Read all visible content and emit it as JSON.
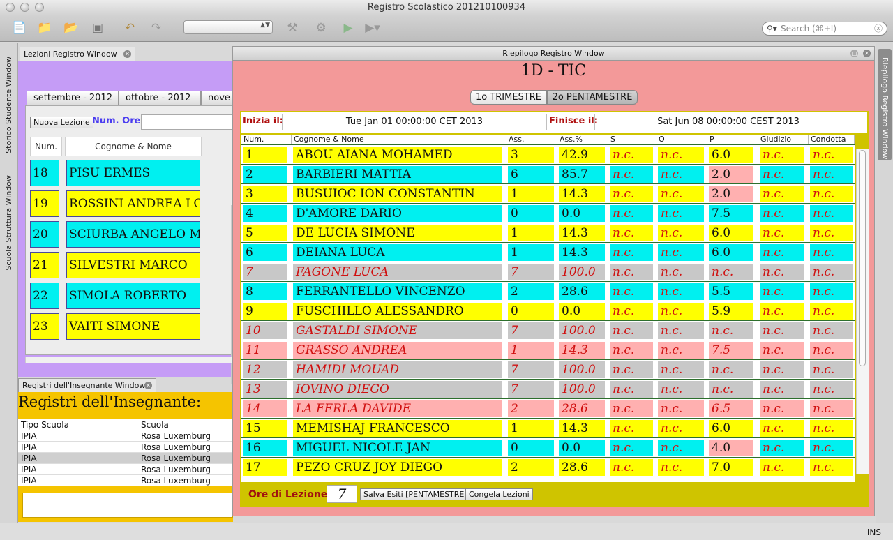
{
  "app": {
    "title": "Registro Scolastico 201210100934"
  },
  "search": {
    "placeholder": "Search (⌘+I)"
  },
  "side_tabs": {
    "left": [
      "Storico Studente Window",
      "Scuola Struttura Window"
    ],
    "right": "Riepilogo Registro Window"
  },
  "status": {
    "mode": "INS"
  },
  "lezioni": {
    "tab_title": "Lezioni Registro Window",
    "months": [
      "settembre - 2012",
      "ottobre - 2012",
      "nove"
    ],
    "new_button": "Nuova Lezione",
    "num_ore_label": "Num. Ore:",
    "headers": [
      "Num.",
      "Cognome & Nome"
    ],
    "rows": [
      {
        "num": "18",
        "name": "PISU ERMES",
        "color": "#00f0f0"
      },
      {
        "num": "19",
        "name": "ROSSINI ANDREA LO",
        "color": "#ffff00"
      },
      {
        "num": "20",
        "name": "SCIURBA ANGELO M.",
        "color": "#00f0f0"
      },
      {
        "num": "21",
        "name": "SILVESTRI MARCO",
        "color": "#ffff00"
      },
      {
        "num": "22",
        "name": "SIMOLA ROBERTO",
        "color": "#00f0f0"
      },
      {
        "num": "23",
        "name": "VAITI SIMONE",
        "color": "#ffff00"
      }
    ]
  },
  "registri": {
    "tab_title": "Registri dell'Insegnante Window",
    "title": "Registri dell'Insegnante:",
    "headers": [
      "Tipo Scuola",
      "Scuola"
    ],
    "rows": [
      {
        "tipo": "IPIA",
        "scuola": "Rosa Luxemburg"
      },
      {
        "tipo": "IPIA",
        "scuola": "Rosa Luxemburg"
      },
      {
        "tipo": "IPIA",
        "scuola": "Rosa Luxemburg"
      },
      {
        "tipo": "IPIA",
        "scuola": "Rosa Luxemburg"
      },
      {
        "tipo": "IPIA",
        "scuola": "Rosa Luxemburg"
      }
    ]
  },
  "riepilogo": {
    "window_title": "Riepilogo Registro Window",
    "class_title": "1D - TIC",
    "tabs": [
      "1o TRIMESTRE",
      "2o PENTAMESTRE"
    ],
    "active_tab": "2o PENTAMESTRE",
    "inizia_label": "Inizia il:",
    "inizia_value": "Tue Jan 01 00:00:00 CET 2013",
    "finisce_label": "Finisce il:",
    "finisce_value": "Sat Jun 08 00:00:00 CEST 2013",
    "columns": [
      "Num.",
      "Cognome & Nome",
      "Ass.",
      "Ass.%",
      "S",
      "O",
      "P",
      "Giudizio",
      "Condotta"
    ],
    "rows": [
      {
        "num": "1",
        "name": "ABOU AIANA MOHAMED",
        "ass": "3",
        "assp": "42.9",
        "s": "n.c.",
        "o": "n.c.",
        "p": "6.0",
        "giud": "n.c.",
        "cond": "n.c.",
        "color": "#ffff00",
        "italic": false,
        "p_color": "#ffff00"
      },
      {
        "num": "2",
        "name": "BARBIERI MATTIA",
        "ass": "6",
        "assp": "85.7",
        "s": "n.c.",
        "o": "n.c.",
        "p": "2.0",
        "giud": "n.c.",
        "cond": "n.c.",
        "color": "#00f0f0",
        "italic": false,
        "p_color": "#ffb0b0"
      },
      {
        "num": "3",
        "name": "BUSUIOC ION CONSTANTIN",
        "ass": "1",
        "assp": "14.3",
        "s": "n.c.",
        "o": "n.c.",
        "p": "2.0",
        "giud": "n.c.",
        "cond": "n.c.",
        "color": "#ffff00",
        "italic": false,
        "p_color": "#ffb0b0"
      },
      {
        "num": "4",
        "name": "D'AMORE DARIO",
        "ass": "0",
        "assp": "0.0",
        "s": "n.c.",
        "o": "n.c.",
        "p": "7.5",
        "giud": "n.c.",
        "cond": "n.c.",
        "color": "#00f0f0",
        "italic": false,
        "p_color": "#00f0f0"
      },
      {
        "num": "5",
        "name": "DE LUCIA SIMONE",
        "ass": "1",
        "assp": "14.3",
        "s": "n.c.",
        "o": "n.c.",
        "p": "6.0",
        "giud": "n.c.",
        "cond": "n.c.",
        "color": "#ffff00",
        "italic": false,
        "p_color": "#ffff00"
      },
      {
        "num": "6",
        "name": "DEIANA LUCA",
        "ass": "1",
        "assp": "14.3",
        "s": "n.c.",
        "o": "n.c.",
        "p": "6.0",
        "giud": "n.c.",
        "cond": "n.c.",
        "color": "#00f0f0",
        "italic": false,
        "p_color": "#00f0f0"
      },
      {
        "num": "7",
        "name": "FAGONE LUCA",
        "ass": "7",
        "assp": "100.0",
        "s": "n.c.",
        "o": "n.c.",
        "p": "n.c.",
        "giud": "n.c.",
        "cond": "n.c.",
        "color": "#c8c8c8",
        "italic": true,
        "p_color": "#c8c8c8"
      },
      {
        "num": "8",
        "name": "FERRANTELLO VINCENZO",
        "ass": "2",
        "assp": "28.6",
        "s": "n.c.",
        "o": "n.c.",
        "p": "5.5",
        "giud": "n.c.",
        "cond": "n.c.",
        "color": "#00f0f0",
        "italic": false,
        "p_color": "#00f0f0"
      },
      {
        "num": "9",
        "name": "FUSCHILLO ALESSANDRO",
        "ass": "0",
        "assp": "0.0",
        "s": "n.c.",
        "o": "n.c.",
        "p": "5.9",
        "giud": "n.c.",
        "cond": "n.c.",
        "color": "#ffff00",
        "italic": false,
        "p_color": "#ffff00"
      },
      {
        "num": "10",
        "name": "GASTALDI SIMONE",
        "ass": "7",
        "assp": "100.0",
        "s": "n.c.",
        "o": "n.c.",
        "p": "n.c.",
        "giud": "n.c.",
        "cond": "n.c.",
        "color": "#c8c8c8",
        "italic": true,
        "p_color": "#c8c8c8"
      },
      {
        "num": "11",
        "name": "GRASSO ANDREA",
        "ass": "1",
        "assp": "14.3",
        "s": "n.c.",
        "o": "n.c.",
        "p": "7.5",
        "giud": "n.c.",
        "cond": "n.c.",
        "color": "#ffb0b0",
        "italic": true,
        "p_color": "#ffb0b0"
      },
      {
        "num": "12",
        "name": "HAMIDI MOUAD",
        "ass": "7",
        "assp": "100.0",
        "s": "n.c.",
        "o": "n.c.",
        "p": "n.c.",
        "giud": "n.c.",
        "cond": "n.c.",
        "color": "#c8c8c8",
        "italic": true,
        "p_color": "#c8c8c8"
      },
      {
        "num": "13",
        "name": "IOVINO DIEGO",
        "ass": "7",
        "assp": "100.0",
        "s": "n.c.",
        "o": "n.c.",
        "p": "n.c.",
        "giud": "n.c.",
        "cond": "n.c.",
        "color": "#c8c8c8",
        "italic": true,
        "p_color": "#c8c8c8"
      },
      {
        "num": "14",
        "name": "LA FERLA DAVIDE",
        "ass": "2",
        "assp": "28.6",
        "s": "n.c.",
        "o": "n.c.",
        "p": "6.5",
        "giud": "n.c.",
        "cond": "n.c.",
        "color": "#ffb0b0",
        "italic": true,
        "p_color": "#ffb0b0"
      },
      {
        "num": "15",
        "name": "MEMISHAJ FRANCESCO",
        "ass": "1",
        "assp": "14.3",
        "s": "n.c.",
        "o": "n.c.",
        "p": "6.0",
        "giud": "n.c.",
        "cond": "n.c.",
        "color": "#ffff00",
        "italic": false,
        "p_color": "#ffff00"
      },
      {
        "num": "16",
        "name": "MIGUEL NICOLE JAN",
        "ass": "0",
        "assp": "0.0",
        "s": "n.c.",
        "o": "n.c.",
        "p": "4.0",
        "giud": "n.c.",
        "cond": "n.c.",
        "color": "#00f0f0",
        "italic": false,
        "p_color": "#ffb0b0"
      },
      {
        "num": "17",
        "name": "PEZO CRUZ JOY DIEGO",
        "ass": "2",
        "assp": "28.6",
        "s": "n.c.",
        "o": "n.c.",
        "p": "7.0",
        "giud": "n.c.",
        "cond": "n.c.",
        "color": "#ffff00",
        "italic": false,
        "p_color": "#ffff00"
      }
    ],
    "ore_label": "Ore di Lezione:",
    "ore_value": "7",
    "salva_button": "Salva Esiti [PENTAMESTRE]",
    "congela_button": "Congela Lezioni"
  },
  "colors": {
    "ok_cell_text": "#111111",
    "nc_cell_text": "#d01010",
    "lezioni_bg": "#c59cf6",
    "registri_bg": "#f5c400",
    "riepilogo_bg": "#f39999",
    "band": "#cfc400"
  },
  "icons": [
    "new-doc-icon",
    "new-project-icon",
    "open-folder-icon",
    "save-all-icon",
    "undo-icon",
    "redo-icon",
    "build-hammer-icon",
    "clean-build-icon",
    "run-icon",
    "debug-icon",
    "search-icon",
    "clear-icon",
    "close-icon"
  ]
}
